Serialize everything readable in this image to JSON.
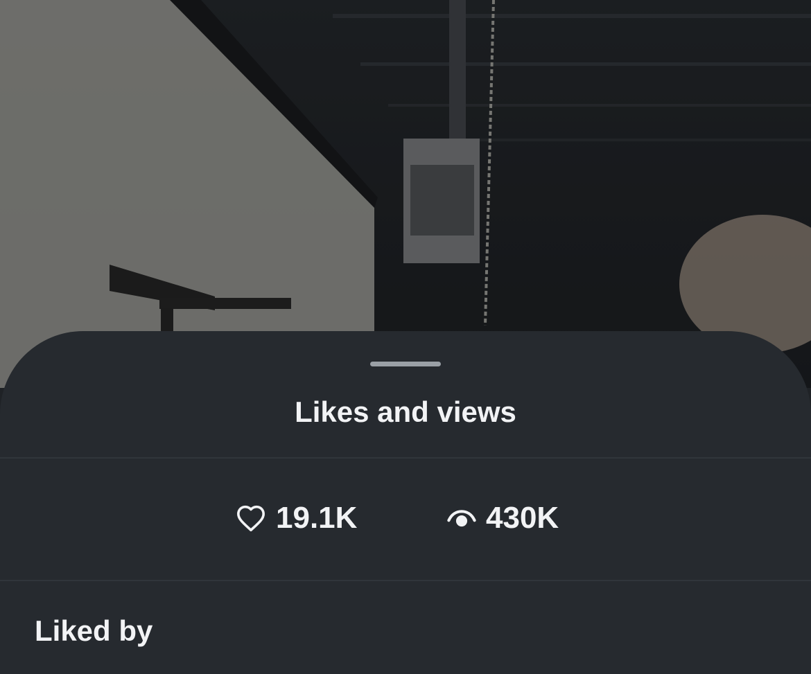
{
  "sheet": {
    "title": "Likes and views",
    "stats": {
      "likes_count": "19.1K",
      "likes_icon": "heart-outline-icon",
      "views_count": "430K",
      "views_icon": "eye-icon"
    },
    "liked_by_heading": "Liked by"
  },
  "colors": {
    "sheet_background": "#262a2f",
    "text_primary": "#f2f3f5",
    "grabber": "#9aa0a6",
    "divider": "#30353b"
  }
}
